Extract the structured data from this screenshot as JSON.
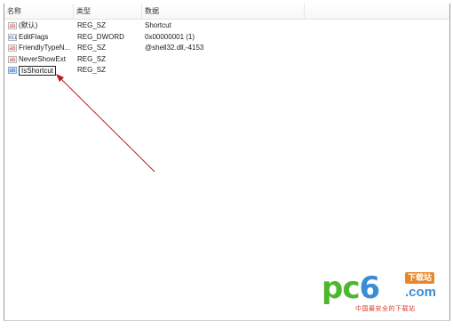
{
  "columns": {
    "name": "名称",
    "type": "类型",
    "data": "数据"
  },
  "rows": [
    {
      "icon": "ab",
      "name": "(默认)",
      "type": "REG_SZ",
      "data": "Shortcut"
    },
    {
      "icon": "011",
      "name": "EditFlags",
      "type": "REG_DWORD",
      "data": "0x00000001 (1)"
    },
    {
      "icon": "ab",
      "name": "FriendlyTypeN...",
      "type": "REG_SZ",
      "data": "@shell32.dll,-4153"
    },
    {
      "icon": "ab",
      "name": "NeverShowExt",
      "type": "REG_SZ",
      "data": ""
    },
    {
      "icon": "ab",
      "name": "IsShortcut",
      "type": "REG_SZ",
      "data": ""
    }
  ],
  "watermark": {
    "logo_pc": "pc",
    "logo_6": "6",
    "badge": "下载站",
    "com": ".com",
    "tagline": "中国最安全的下载站"
  },
  "colors": {
    "arrow": "#b42020",
    "logo_green": "#4db82f",
    "logo_blue": "#3a8ed6",
    "badge_orange": "#e8862b",
    "tagline_red": "#d83b2f"
  }
}
